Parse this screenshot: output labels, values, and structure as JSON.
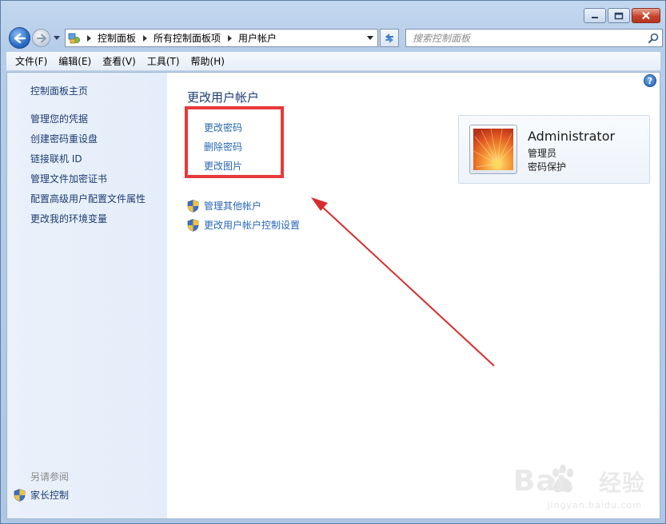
{
  "window": {
    "caption": {
      "minimize": "minimize",
      "maximize": "maximize",
      "close": "close"
    }
  },
  "address": {
    "crumbs": [
      "控制面板",
      "所有控制面板项",
      "用户帐户"
    ]
  },
  "search": {
    "placeholder": "搜索控制面板"
  },
  "menu": {
    "items": [
      "文件(F)",
      "编辑(E)",
      "查看(V)",
      "工具(T)",
      "帮助(H)"
    ]
  },
  "sidebar": {
    "home": "控制面板主页",
    "links": [
      "管理您的凭据",
      "创建密码重设盘",
      "链接联机 ID",
      "管理文件加密证书",
      "配置高级用户配置文件属性",
      "更改我的环境变量"
    ],
    "see_also": "另请参阅",
    "parental": "家长控制"
  },
  "main": {
    "title": "更改用户帐户",
    "tasks": [
      "更改密码",
      "删除密码",
      "更改图片"
    ],
    "shield_tasks": [
      "管理其他帐户",
      "更改用户帐户控制设置"
    ]
  },
  "account": {
    "name": "Administrator",
    "role": "管理员",
    "status": "密码保护"
  },
  "watermark": {
    "brand": "Bai",
    "brand2": "经验",
    "url": "jingyan.baidu.com"
  },
  "colors": {
    "link": "#2767b5",
    "heading": "#1e3c73",
    "highlight": "#e8393b",
    "arrow": "#d92b2b"
  }
}
